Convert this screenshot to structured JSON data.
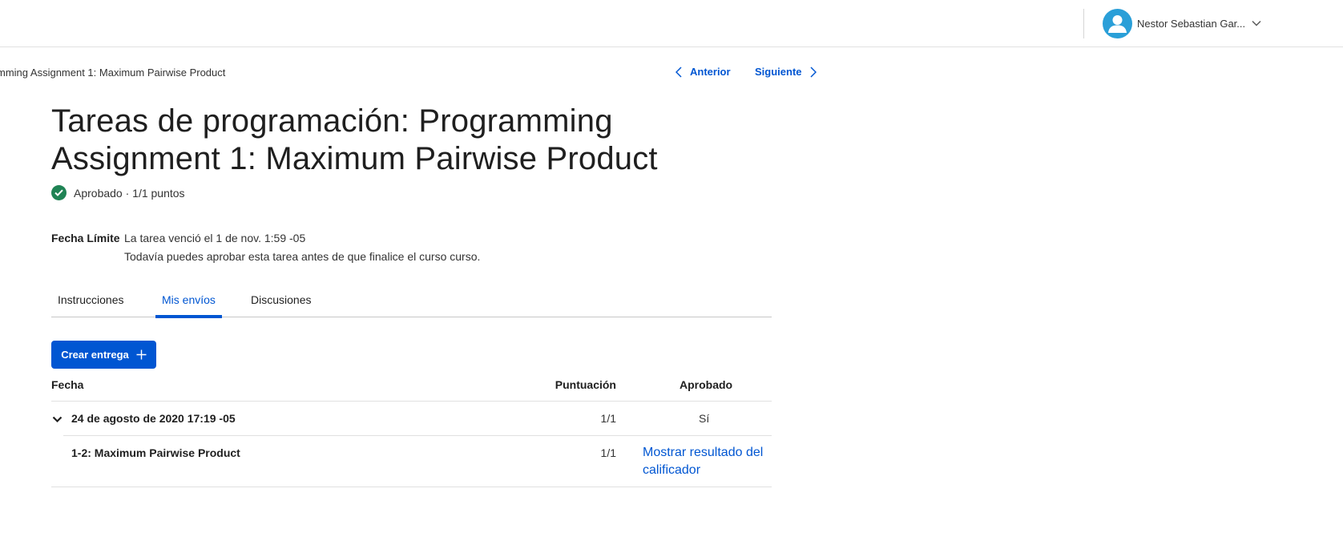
{
  "header": {
    "user_name": "Nestor Sebastian Gar..."
  },
  "breadcrumb": "mming Assignment 1: Maximum Pairwise Product",
  "nav": {
    "previous_label": "Anterior",
    "next_label": "Siguiente"
  },
  "page": {
    "title": "Tareas de programación: Programming Assignment 1: Maximum Pairwise Product",
    "status": "Aprobado · 1/1 puntos",
    "deadline_label": "Fecha Límite",
    "deadline_line1": "La tarea venció el 1 de nov. 1:59 -05",
    "deadline_line2": "Todavía puedes aprobar esta tarea antes de que finalice el curso curso."
  },
  "tabs": [
    {
      "label": "Instrucciones",
      "active": false
    },
    {
      "label": "Mis envíos",
      "active": true
    },
    {
      "label": "Discusiones",
      "active": false
    }
  ],
  "create_button_label": "Crear entrega",
  "table": {
    "headers": {
      "date": "Fecha",
      "score": "Puntuación",
      "passed": "Aprobado"
    },
    "submission": {
      "date": "24 de agosto de 2020 17:19 -05",
      "score": "1/1",
      "passed": "Sí",
      "part": {
        "name": "1-2: Maximum Pairwise Product",
        "score": "1/1",
        "link_label": "Mostrar resultado del calificador"
      }
    }
  },
  "colors": {
    "accent": "#0056d2",
    "success": "#1f8354",
    "avatar": "#2a9fd8"
  },
  "icons": {
    "avatar": "user-avatar-icon",
    "user_menu": "chevron-down-icon",
    "previous": "chevron-left-icon",
    "next": "chevron-right-icon",
    "status": "check-circle-icon",
    "create": "plus-icon",
    "expand": "chevron-down-icon"
  }
}
